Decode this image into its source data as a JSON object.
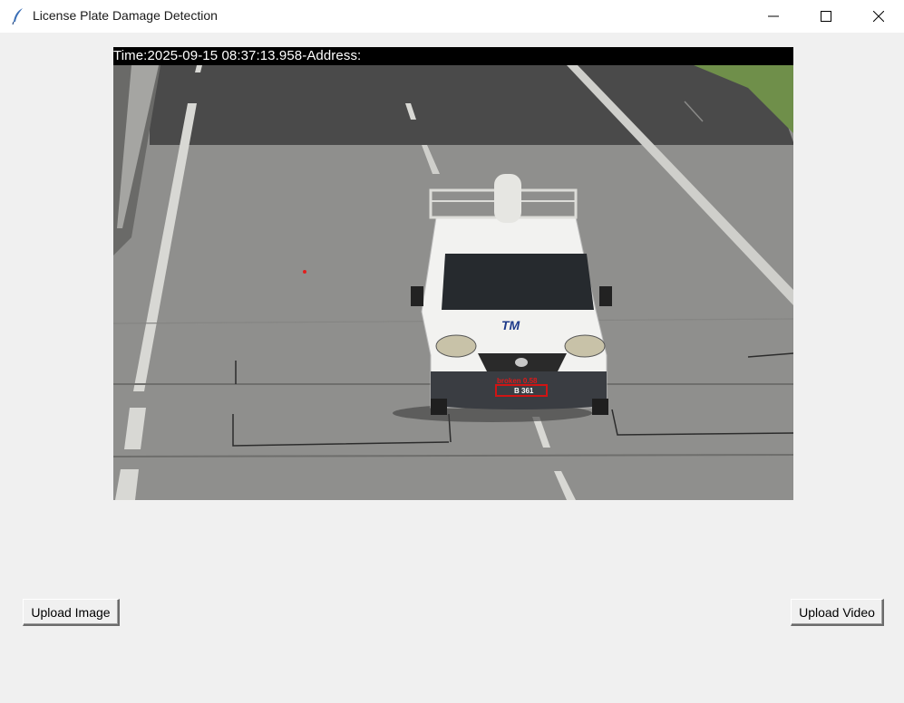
{
  "window": {
    "title": "License Plate Damage Detection",
    "icons": {
      "app": "feather-icon",
      "minimize": "minimize-icon",
      "maximize": "maximize-icon",
      "close": "close-icon"
    }
  },
  "frame": {
    "overlay_text": "Time:2025-09-15 08:37:13.958-Address:",
    "detection_label": "broken 0.58",
    "plate_text": "B 361",
    "vehicle_logo": "TM",
    "colors": {
      "detection": "#d01414",
      "overlay_bg": "#000000",
      "overlay_text": "#ffffff"
    }
  },
  "buttons": {
    "upload_image": "Upload Image",
    "upload_video": "Upload Video"
  }
}
